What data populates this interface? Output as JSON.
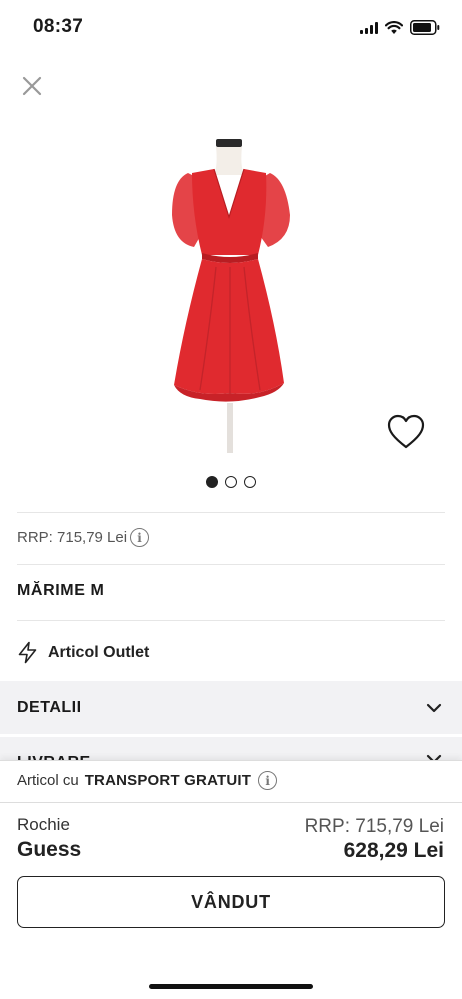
{
  "status_bar": {
    "time": "08:37"
  },
  "product": {
    "image_alt": "Red chiffon dress with flutter sleeves on mannequin",
    "dress_color": "#e02a2f",
    "carousel": {
      "count": 3,
      "active_index": 0
    },
    "rrp_text": "RRP: 715,79 Lei",
    "size_text": "MĂRIME M",
    "outlet_text": "Articol Outlet"
  },
  "accordions": [
    {
      "label": "DETALII"
    },
    {
      "label": "LIVRARE"
    }
  ],
  "bottom_sheet": {
    "shipping_prefix": "Articol cu",
    "shipping_strong": "TRANSPORT GRATUIT",
    "type": "Rochie",
    "brand": "Guess",
    "price_rrp": "RRP: 715,79 Lei",
    "price_now": "628,29 Lei",
    "button_label": "VÂNDUT"
  },
  "icons": [
    "close-icon",
    "heart-icon",
    "info-icon",
    "lightning-icon",
    "chevron-down-icon",
    "signal-icon",
    "wifi-icon",
    "battery-icon"
  ]
}
